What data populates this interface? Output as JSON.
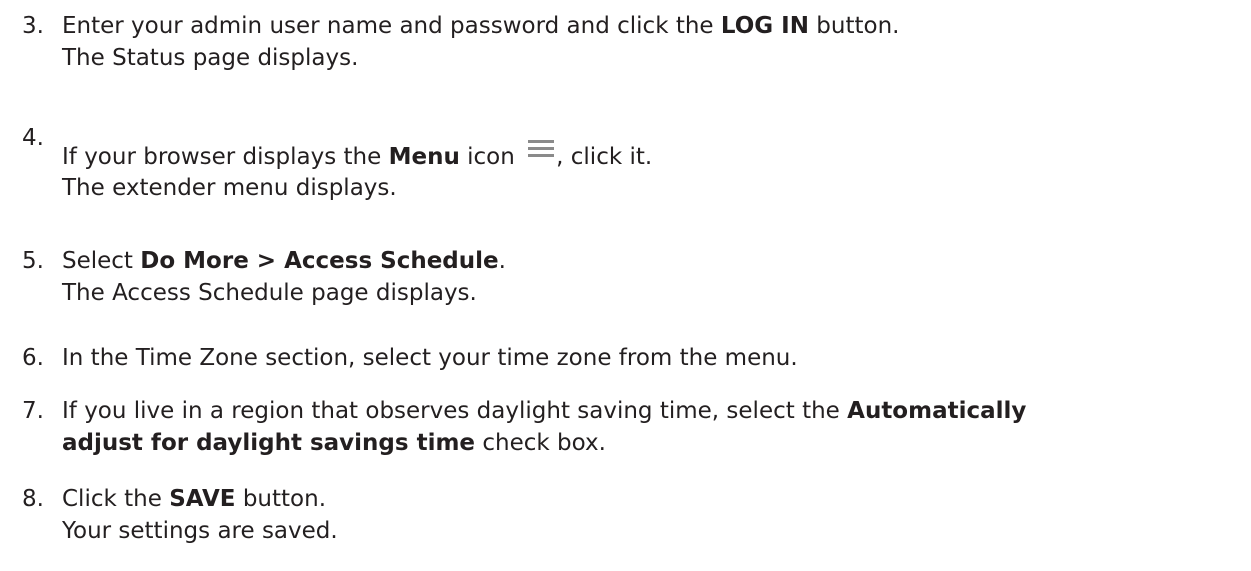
{
  "steps": [
    {
      "number": "3.",
      "pre": "Enter your admin user name and password and click the ",
      "bold": "LOG IN",
      "post": " button.",
      "result": "The Status page displays."
    },
    {
      "number": "4.",
      "pre": "If your browser displays the ",
      "bold": "Menu",
      "mid": " icon ",
      "icon": "hamburger-menu-icon",
      "post": ", click it.",
      "result": "The extender menu displays."
    },
    {
      "number": "5.",
      "pre": "Select ",
      "bold": "Do More > Access Schedule",
      "post": ".",
      "result": "The Access Schedule page displays."
    },
    {
      "number": "6.",
      "text": "In the Time Zone section, select your time zone from the menu."
    },
    {
      "number": "7.",
      "pre": "If you live in a region that observes daylight saving time, select the ",
      "bold1": "Automatically",
      "bold2": "adjust for daylight savings time",
      "post": " check box."
    },
    {
      "number": "8.",
      "pre": "Click the ",
      "bold": "SAVE",
      "post": " button.",
      "result": "Your settings are saved."
    }
  ],
  "colors": {
    "text": "#231f20",
    "icon": "#8a8a8a"
  }
}
